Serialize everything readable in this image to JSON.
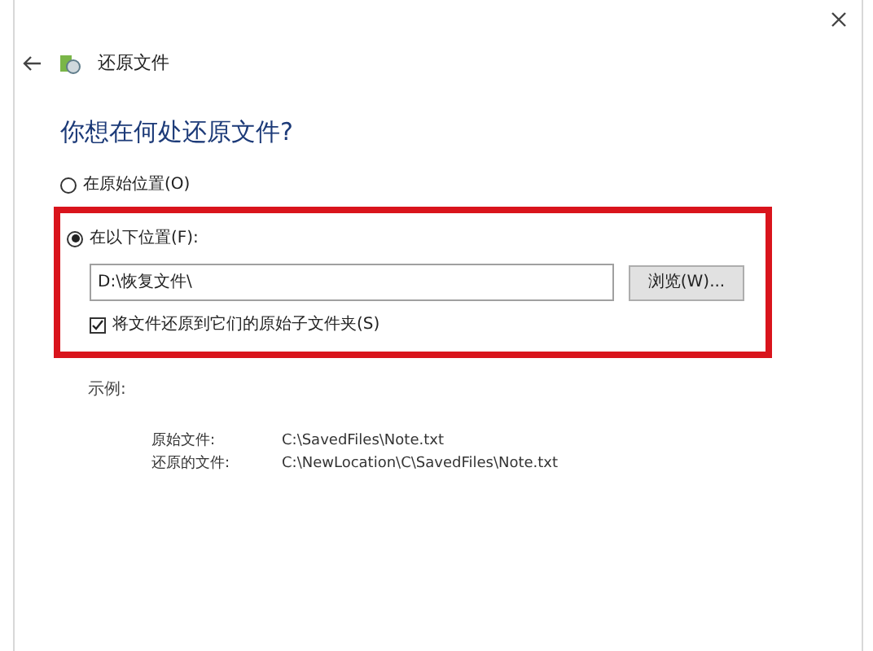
{
  "window": {
    "title": "还原文件"
  },
  "heading": "你想在何处还原文件?",
  "options": [
    {
      "label": "在原始位置(O)",
      "selected": false
    },
    {
      "label": "在以下位置(F):",
      "selected": true
    }
  ],
  "location": {
    "value": "D:\\恢复文件\\",
    "browse_button": "浏览(W)...",
    "subfolders": {
      "label": "将文件还原到它们的原始子文件夹(S)",
      "checked": true
    }
  },
  "example": {
    "title": "示例:",
    "rows": [
      {
        "label": "原始文件:",
        "value": "C:\\SavedFiles\\Note.txt"
      },
      {
        "label": "还原的文件:",
        "value": "C:\\NewLocation\\C\\SavedFiles\\Note.txt"
      }
    ]
  }
}
